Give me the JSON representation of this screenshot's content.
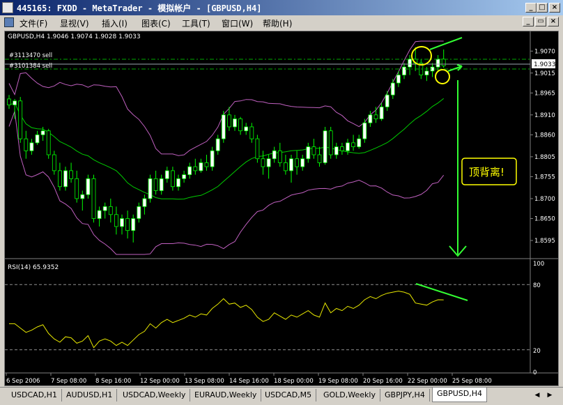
{
  "window": {
    "title": "445165: FXDD - MetaTrader - 模拟帐户 - [GBPUSD,H4]"
  },
  "menu": [
    "文件(F)",
    "显视(V)",
    "插入(I)",
    "图表(C)",
    "工具(T)",
    "窗口(W)",
    "帮助(H)"
  ],
  "chart": {
    "header": "GBPUSD,H4  1.9046 1.9074 1.9028 1.9033",
    "order1": "#3113470 sell",
    "order2": "#3101384 sell",
    "current_price": "1.9033",
    "price_ticks": [
      "1.9070",
      "1.9015",
      "1.8965",
      "1.8910",
      "1.8860",
      "1.8805",
      "1.8755",
      "1.8700",
      "1.8650",
      "1.8595"
    ],
    "annotation": "顶背离!",
    "rsi_label": "RSI(14) 65.9352",
    "rsi_ticks": [
      "100",
      "80",
      "20",
      "0"
    ],
    "time_labels": [
      "6 Sep 2006",
      "7 Sep 08:00",
      "8 Sep 16:00",
      "12 Sep 00:00",
      "13 Sep 08:00",
      "14 Sep 16:00",
      "18 Sep 00:00",
      "19 Sep 08:00",
      "20 Sep 16:00",
      "22 Sep 00:00",
      "25 Sep 08:00"
    ]
  },
  "tabs": [
    "USDCAD,H1",
    "AUDUSD,H1",
    "USDCAD,Weekly",
    "EURAUD,Weekly",
    "USDCAD,M5",
    "GOLD,Weekly",
    "GBPJPY,H4",
    "GBPUSD,H4"
  ],
  "active_tab": "GBPUSD,H4",
  "colors": {
    "bull": "#ffffff",
    "bear": "#000000",
    "wick": "#00ff00",
    "band": "#c060c0",
    "ma": "#00cc00",
    "rsi": "#e8e800",
    "annotation": "#ffff00",
    "arrow": "#33ff33",
    "order_line": "#00aa00"
  },
  "chart_data": {
    "type": "candlestick",
    "symbol": "GBPUSD",
    "timeframe": "H4",
    "ylim": [
      1.856,
      1.9095
    ],
    "candles": [
      [
        1.895,
        1.896,
        1.8925,
        1.8935
      ],
      [
        1.8935,
        1.895,
        1.89,
        1.8945
      ],
      [
        1.8945,
        1.8955,
        1.884,
        1.885
      ],
      [
        1.885,
        1.887,
        1.88,
        1.882
      ],
      [
        1.882,
        1.885,
        1.881,
        1.884
      ],
      [
        1.884,
        1.887,
        1.8835,
        1.886
      ],
      [
        1.886,
        1.888,
        1.8845,
        1.887
      ],
      [
        1.887,
        1.8875,
        1.88,
        1.881
      ],
      [
        1.881,
        1.882,
        1.876,
        1.877
      ],
      [
        1.877,
        1.879,
        1.872,
        1.873
      ],
      [
        1.873,
        1.878,
        1.872,
        1.877
      ],
      [
        1.877,
        1.879,
        1.874,
        1.875
      ],
      [
        1.875,
        1.877,
        1.869,
        1.87
      ],
      [
        1.87,
        1.872,
        1.867,
        1.871
      ],
      [
        1.871,
        1.876,
        1.87,
        1.875
      ],
      [
        1.875,
        1.876,
        1.864,
        1.865
      ],
      [
        1.865,
        1.868,
        1.863,
        1.867
      ],
      [
        1.867,
        1.869,
        1.865,
        1.868
      ],
      [
        1.868,
        1.87,
        1.864,
        1.866
      ],
      [
        1.866,
        1.868,
        1.861,
        1.863
      ],
      [
        1.863,
        1.866,
        1.861,
        1.865
      ],
      [
        1.865,
        1.867,
        1.86,
        1.862
      ],
      [
        1.862,
        1.866,
        1.859,
        1.865
      ],
      [
        1.865,
        1.869,
        1.864,
        1.868
      ],
      [
        1.868,
        1.871,
        1.866,
        1.87
      ],
      [
        1.87,
        1.876,
        1.869,
        1.875
      ],
      [
        1.875,
        1.877,
        1.871,
        1.872
      ],
      [
        1.872,
        1.876,
        1.871,
        1.875
      ],
      [
        1.875,
        1.878,
        1.874,
        1.877
      ],
      [
        1.877,
        1.878,
        1.872,
        1.873
      ],
      [
        1.873,
        1.876,
        1.872,
        1.875
      ],
      [
        1.875,
        1.877,
        1.874,
        1.876
      ],
      [
        1.876,
        1.879,
        1.875,
        1.878
      ],
      [
        1.878,
        1.88,
        1.876,
        1.877
      ],
      [
        1.877,
        1.88,
        1.8765,
        1.879
      ],
      [
        1.879,
        1.881,
        1.877,
        1.878
      ],
      [
        1.878,
        1.883,
        1.877,
        1.882
      ],
      [
        1.882,
        1.886,
        1.881,
        1.885
      ],
      [
        1.885,
        1.892,
        1.884,
        1.891
      ],
      [
        1.891,
        1.893,
        1.887,
        1.888
      ],
      [
        1.888,
        1.891,
        1.887,
        1.89
      ],
      [
        1.89,
        1.8905,
        1.886,
        1.887
      ],
      [
        1.887,
        1.889,
        1.886,
        1.888
      ],
      [
        1.888,
        1.889,
        1.884,
        1.885
      ],
      [
        1.885,
        1.886,
        1.879,
        1.88
      ],
      [
        1.88,
        1.882,
        1.876,
        1.878
      ],
      [
        1.878,
        1.881,
        1.875,
        1.88
      ],
      [
        1.88,
        1.883,
        1.879,
        1.882
      ],
      [
        1.882,
        1.884,
        1.878,
        1.879
      ],
      [
        1.879,
        1.881,
        1.876,
        1.877
      ],
      [
        1.877,
        1.881,
        1.874,
        1.88
      ],
      [
        1.88,
        1.882,
        1.876,
        1.878
      ],
      [
        1.878,
        1.881,
        1.877,
        1.88
      ],
      [
        1.88,
        1.884,
        1.879,
        1.883
      ],
      [
        1.883,
        1.885,
        1.88,
        1.881
      ],
      [
        1.881,
        1.883,
        1.878,
        1.879
      ],
      [
        1.879,
        1.888,
        1.8785,
        1.887
      ],
      [
        1.887,
        1.888,
        1.88,
        1.881
      ],
      [
        1.881,
        1.884,
        1.88,
        1.883
      ],
      [
        1.883,
        1.884,
        1.881,
        1.882
      ],
      [
        1.882,
        1.885,
        1.881,
        1.884
      ],
      [
        1.884,
        1.886,
        1.882,
        1.883
      ],
      [
        1.883,
        1.886,
        1.8825,
        1.885
      ],
      [
        1.885,
        1.89,
        1.884,
        1.889
      ],
      [
        1.889,
        1.892,
        1.888,
        1.891
      ],
      [
        1.891,
        1.893,
        1.889,
        1.89
      ],
      [
        1.89,
        1.894,
        1.8895,
        1.893
      ],
      [
        1.893,
        1.897,
        1.892,
        1.896
      ],
      [
        1.896,
        1.9,
        1.895,
        1.899
      ],
      [
        1.899,
        1.902,
        1.898,
        1.901
      ],
      [
        1.901,
        1.904,
        1.9,
        1.903
      ],
      [
        1.903,
        1.906,
        1.901,
        1.905
      ],
      [
        1.905,
        1.908,
        1.902,
        1.904
      ],
      [
        1.904,
        1.905,
        1.9,
        1.901
      ],
      [
        1.901,
        1.903,
        1.8995,
        1.902
      ],
      [
        1.902,
        1.904,
        1.9005,
        1.903
      ],
      [
        1.903,
        1.906,
        1.902,
        1.905
      ],
      [
        1.905,
        1.9074,
        1.9028,
        1.9033
      ]
    ],
    "rsi": [
      44,
      44,
      40,
      36,
      38,
      41,
      43,
      35,
      30,
      27,
      32,
      31,
      26,
      28,
      33,
      22,
      28,
      30,
      28,
      24,
      27,
      24,
      29,
      34,
      37,
      44,
      40,
      45,
      48,
      45,
      47,
      49,
      52,
      50,
      53,
      52,
      58,
      62,
      67,
      62,
      63,
      59,
      61,
      57,
      50,
      46,
      48,
      54,
      51,
      48,
      52,
      50,
      53,
      56,
      52,
      50,
      63,
      54,
      58,
      56,
      60,
      58,
      61,
      66,
      69,
      67,
      70,
      72,
      73,
      74,
      73,
      71,
      63,
      62,
      61,
      64,
      66,
      65.9
    ],
    "rsi_levels": [
      80,
      20
    ],
    "rsi_ylim": [
      0,
      100
    ]
  }
}
